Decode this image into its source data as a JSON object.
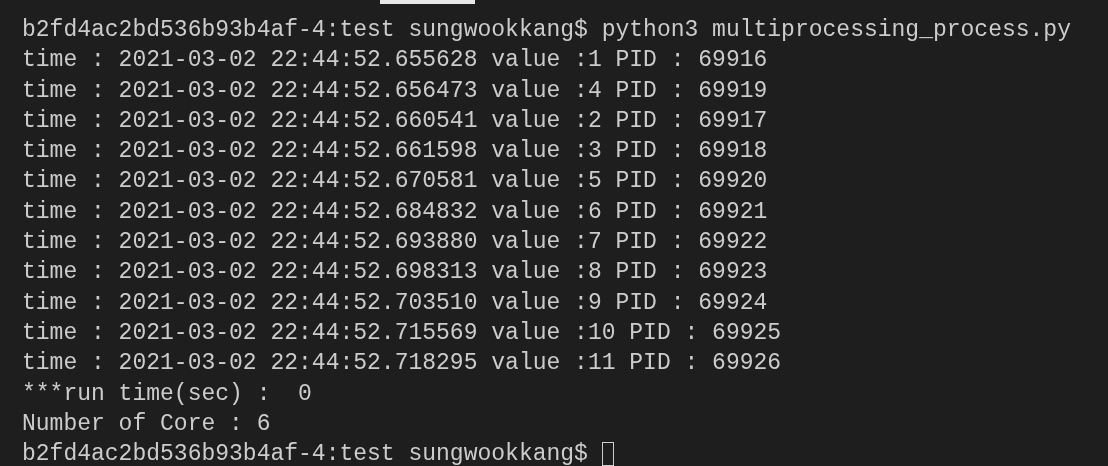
{
  "terminal": {
    "lines": [
      "b2fd4ac2bd536b93b4af-4:test sungwookkang$ python3 multiprocessing_process.py",
      "time : 2021-03-02 22:44:52.655628 value :1 PID : 69916",
      "time : 2021-03-02 22:44:52.656473 value :4 PID : 69919",
      "time : 2021-03-02 22:44:52.660541 value :2 PID : 69917",
      "time : 2021-03-02 22:44:52.661598 value :3 PID : 69918",
      "time : 2021-03-02 22:44:52.670581 value :5 PID : 69920",
      "time : 2021-03-02 22:44:52.684832 value :6 PID : 69921",
      "time : 2021-03-02 22:44:52.693880 value :7 PID : 69922",
      "time : 2021-03-02 22:44:52.698313 value :8 PID : 69923",
      "time : 2021-03-02 22:44:52.703510 value :9 PID : 69924",
      "time : 2021-03-02 22:44:52.715569 value :10 PID : 69925",
      "time : 2021-03-02 22:44:52.718295 value :11 PID : 69926",
      "***run time(sec) :  0",
      "Number of Core : 6"
    ],
    "prompt": "b2fd4ac2bd536b93b4af-4:test sungwookkang$ "
  }
}
